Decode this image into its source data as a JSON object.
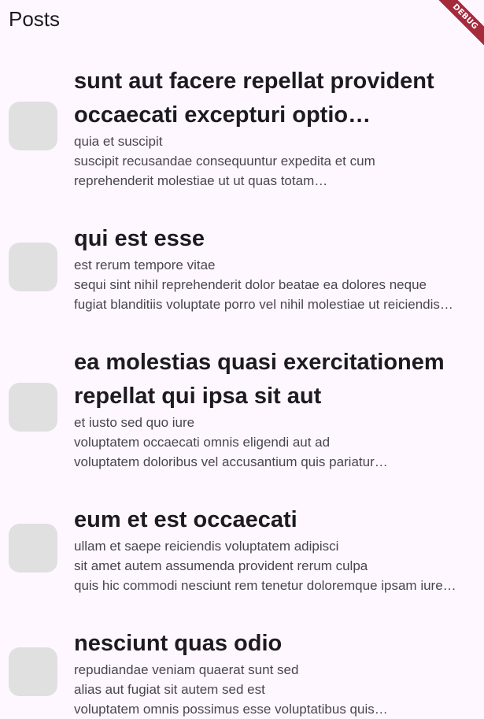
{
  "app_bar": {
    "title": "Posts",
    "debug_banner": "DEBUG",
    "debug_banner_color": "#A52A3A"
  },
  "colors": {
    "background": "#FEF7FF",
    "thumbnail": "#E0E0E0",
    "title_text": "#1D1B20",
    "body_text": "#49454F"
  },
  "posts": [
    {
      "title": "sunt aut facere repellat provident occaecati excepturi optio reprehenderit",
      "body": "quia et suscipit\nsuscipit recusandae consequuntur expedita et cum\nreprehenderit molestiae ut ut quas totam\nnostrum rerum est autem sunt rem eveniet architecto"
    },
    {
      "title": "qui est esse",
      "body": "est rerum tempore vitae\nsequi sint nihil reprehenderit dolor beatae ea dolores neque\nfugiat blanditiis voluptate porro vel nihil molestiae ut reiciendis\nqui aperiam non debitis possimus qui neque nisi nulla"
    },
    {
      "title": "ea molestias quasi exercitationem repellat qui ipsa sit aut",
      "body": "et iusto sed quo iure\nvoluptatem occaecati omnis eligendi aut ad\nvoluptatem doloribus vel accusantium quis pariatur\nmolestiae porro eius odio et labore et velit aut"
    },
    {
      "title": "eum et est occaecati",
      "body": "ullam et saepe reiciendis voluptatem adipisci\nsit amet autem assumenda provident rerum culpa\nquis hic commodi nesciunt rem tenetur doloremque ipsam iure\nquis sunt voluptatem rerum illo velit"
    },
    {
      "title": "nesciunt quas odio",
      "body": "repudiandae veniam quaerat sunt sed\nalias aut fugiat sit autem sed est\nvoluptatem omnis possimus esse voluptatibus quis\nest aut tenetur dolor neque"
    }
  ]
}
